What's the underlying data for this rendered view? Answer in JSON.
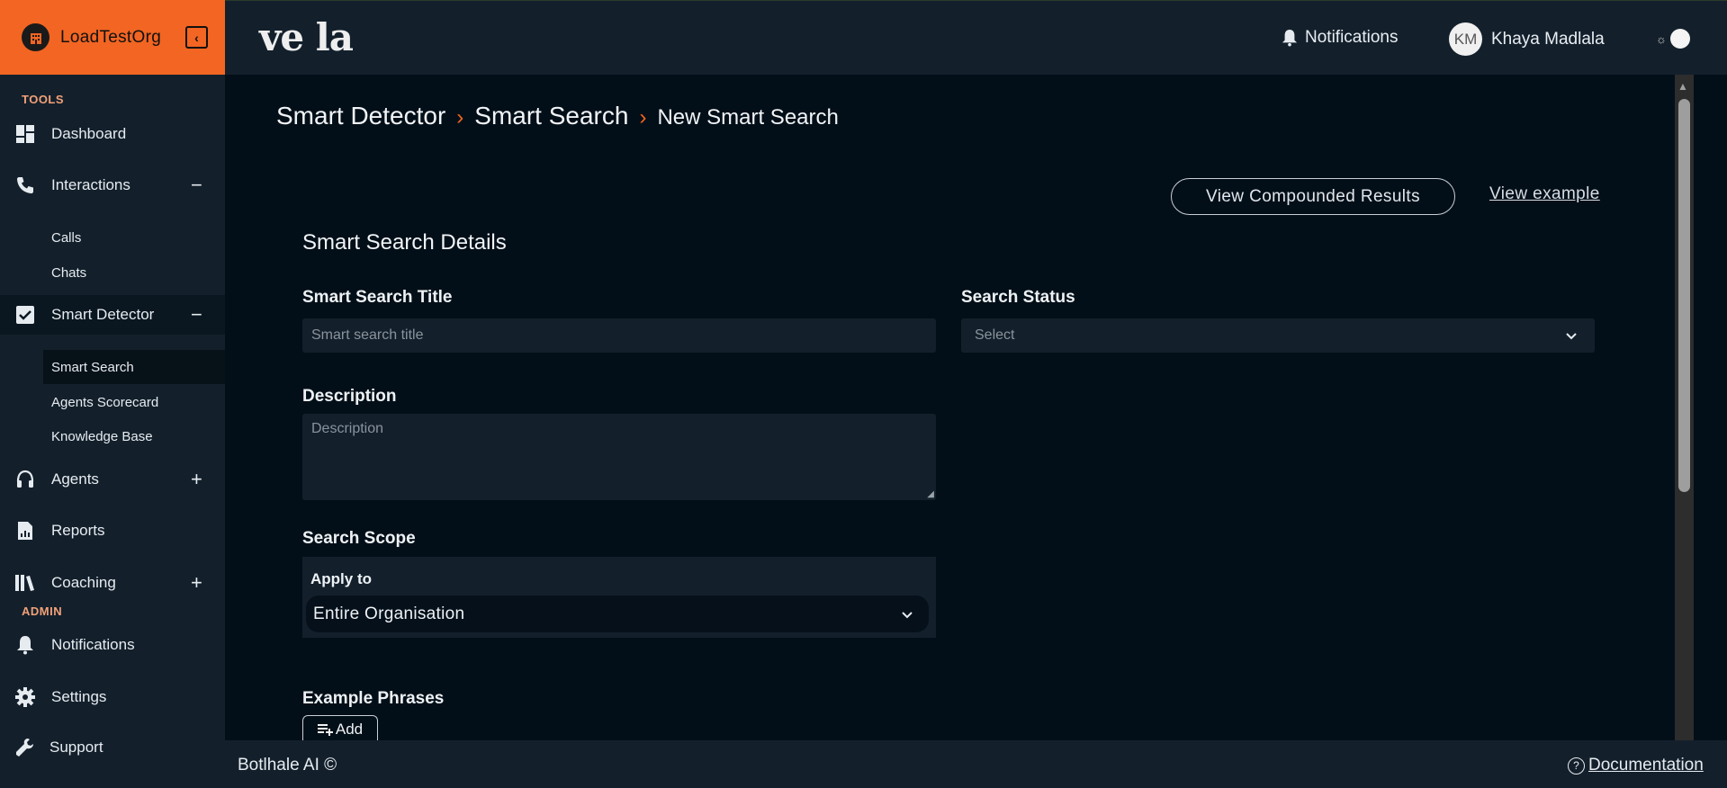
{
  "org": {
    "name": "LoadTestOrg"
  },
  "sidebar": {
    "tools_label": "TOOLS",
    "admin_label": "ADMIN",
    "items": [
      {
        "label": "Dashboard"
      },
      {
        "label": "Interactions",
        "toggle": "−"
      },
      {
        "label": "Smart Detector",
        "toggle": "−"
      },
      {
        "label": "Agents",
        "toggle": "+"
      },
      {
        "label": "Reports"
      },
      {
        "label": "Coaching",
        "toggle": "+"
      },
      {
        "label": "Notifications"
      },
      {
        "label": "Settings"
      },
      {
        "label": "Support"
      }
    ],
    "interactions_sub": [
      "Calls",
      "Chats"
    ],
    "smart_detector_sub": [
      "Smart Search",
      "Agents Scorecard",
      "Knowledge Base"
    ]
  },
  "header": {
    "brand": "ve  la",
    "notifications_label": "Notifications",
    "user_initials": "KM",
    "user_name": "Khaya Madlala"
  },
  "breadcrumb": [
    "Smart Detector",
    "Smart Search",
    "New Smart Search"
  ],
  "actions": {
    "compounded_label": "View Compounded Results",
    "example_label": "View example"
  },
  "form": {
    "section_title": "Smart Search Details",
    "title_label": "Smart Search Title",
    "title_placeholder": "Smart search title",
    "status_label": "Search Status",
    "status_value": "Select",
    "description_label": "Description",
    "description_placeholder": "Description",
    "scope_label": "Search Scope",
    "apply_to_label": "Apply to",
    "apply_to_value": "Entire Organisation",
    "phrases_label": "Example Phrases",
    "add_label": "Add"
  },
  "footer": {
    "copyright": "Botlhale AI ©",
    "documentation": "Documentation"
  },
  "colors": {
    "accent": "#f26522",
    "sidebar_bg": "#13202c",
    "main_bg": "#030f18"
  }
}
